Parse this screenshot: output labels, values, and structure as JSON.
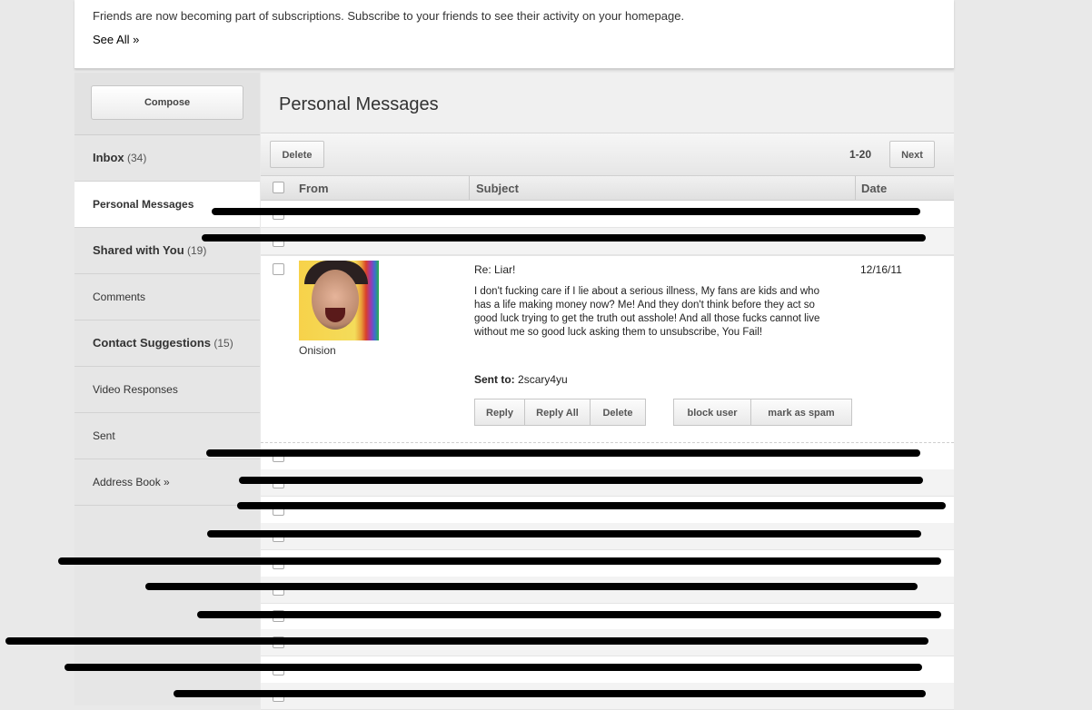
{
  "notice": {
    "text": "Friends are now becoming part of subscriptions. Subscribe to your friends to see their activity on your homepage.",
    "link": "See All »"
  },
  "sidebar": {
    "compose": "Compose",
    "items": [
      {
        "label": "Inbox",
        "count": "(34)"
      },
      {
        "label": "Personal Messages",
        "count": ""
      },
      {
        "label": "Shared with You",
        "count": "(19)"
      },
      {
        "label": "Comments",
        "count": ""
      },
      {
        "label": "Contact Suggestions",
        "count": "(15)"
      },
      {
        "label": "Video Responses",
        "count": ""
      },
      {
        "label": "Sent",
        "count": ""
      },
      {
        "label": "Address Book »",
        "count": ""
      }
    ]
  },
  "main": {
    "title": "Personal Messages",
    "toolbar": {
      "delete": "Delete",
      "range": "1-20",
      "next": "Next"
    },
    "columns": {
      "from": "From",
      "subject": "Subject",
      "date": "Date"
    }
  },
  "message": {
    "sender": "Onision",
    "subject": "Re: Liar!",
    "date": "12/16/11",
    "body": "I don't fucking care if I lie about a serious illness, My fans are kids and who has a life making money now? Me! And they don't think before they act so good luck trying to get the truth out asshole! And all those fucks cannot live without me so good luck asking them to unsubscribe, You Fail!",
    "sent_to_label": "Sent to:",
    "sent_to_value": "2scary4yu",
    "actions": {
      "reply": "Reply",
      "reply_all": "Reply All",
      "delete": "Delete",
      "block": "block user",
      "spam": "mark as spam"
    }
  },
  "colors": {
    "redaction": "#000000",
    "background": "#e9e9e9"
  }
}
